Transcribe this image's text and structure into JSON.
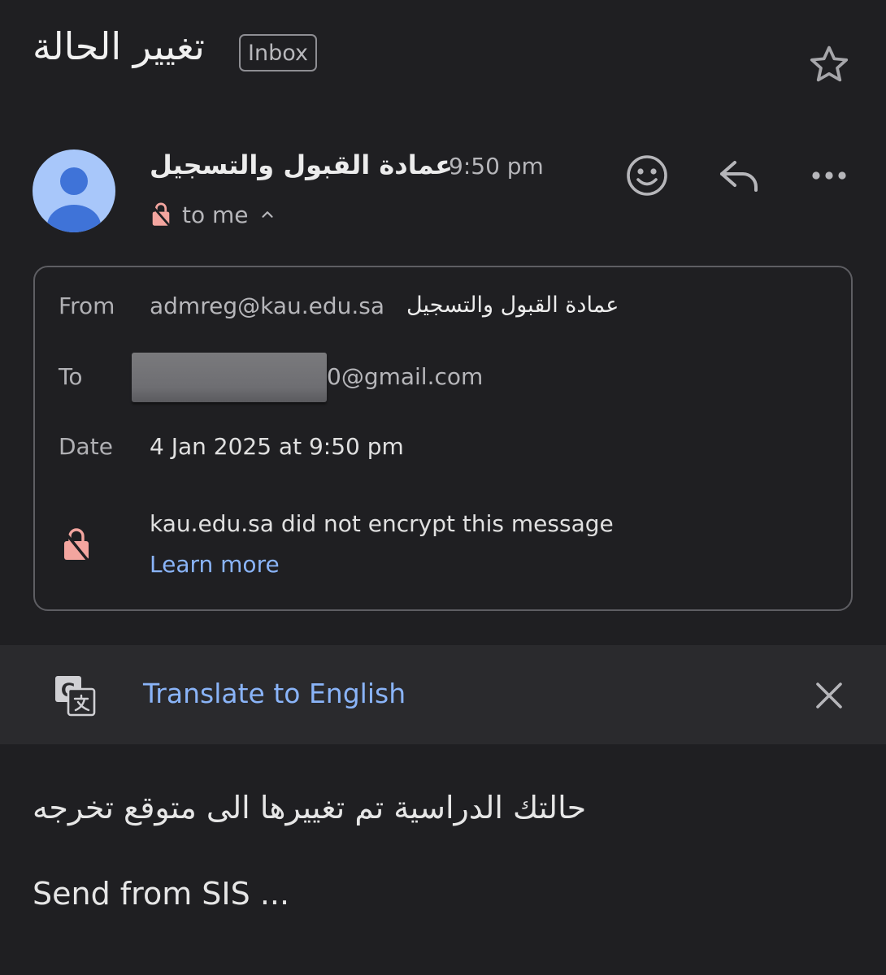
{
  "header": {
    "subject": "تغيير الحالة",
    "label": "Inbox"
  },
  "sender": {
    "name": "عمادة القبول والتسجيل",
    "time": "9:50 pm",
    "recipient_summary": "to me"
  },
  "details": {
    "from_label": "From",
    "from_email": "admreg@kau.edu.sa",
    "from_name": "عمادة القبول والتسجيل",
    "to_label": "To",
    "to_email_visible": "0@gmail.com",
    "date_label": "Date",
    "date_value": "4 Jan 2025 at 9:50 pm",
    "encryption_notice": "kau.edu.sa did not encrypt this message",
    "learn_more": "Learn more"
  },
  "translate": {
    "label": "Translate to English"
  },
  "body": {
    "arabic_line": "حالتك الدراسية تم تغييرها الى متوقع تخرجه",
    "footer_line": "Send from SIS ..."
  },
  "colors": {
    "background": "#1f1f22",
    "link": "#8ab4f8",
    "avatar_bg": "#a8c7fa",
    "avatar_fg": "#3f73d8",
    "lock": "#f3a59f"
  }
}
